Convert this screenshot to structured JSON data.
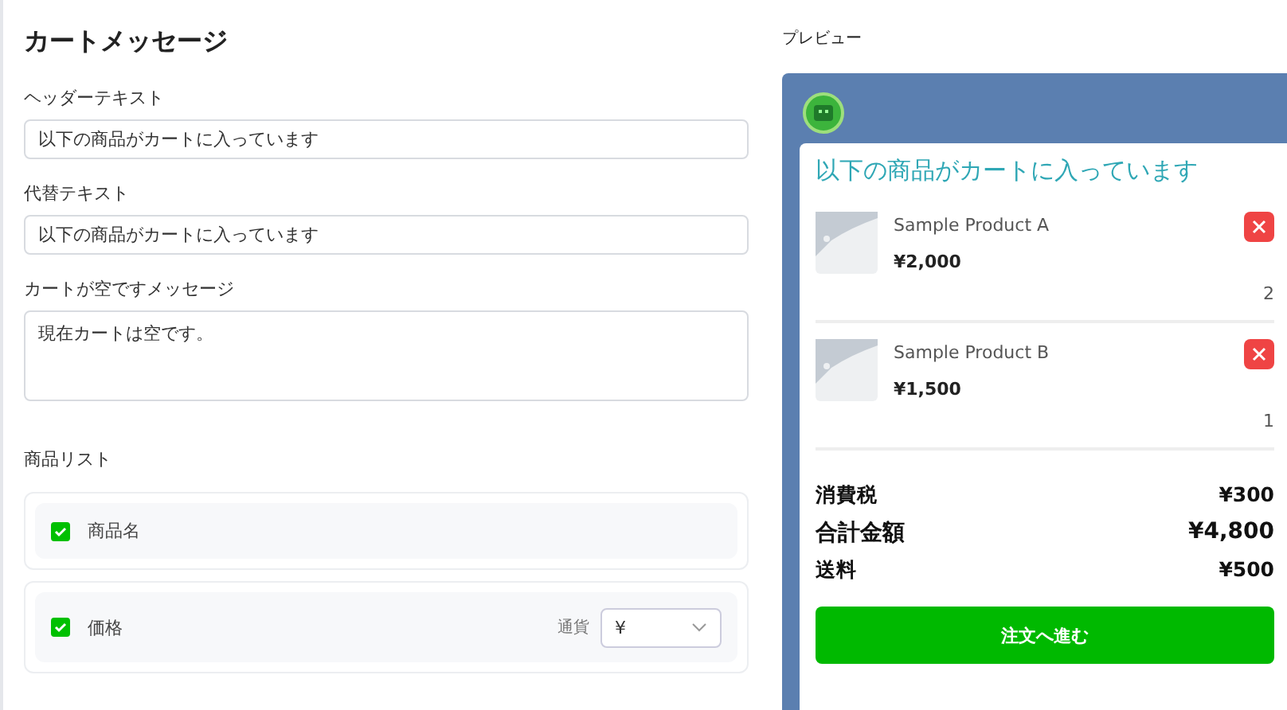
{
  "settings": {
    "title": "カートメッセージ",
    "fields": [
      {
        "label": "ヘッダーテキスト",
        "value": "以下の商品がカートに入っています",
        "kind": "input"
      },
      {
        "label": "代替テキスト",
        "value": "以下の商品がカートに入っています",
        "kind": "input"
      },
      {
        "label": "カートが空ですメッセージ",
        "value": "現在カートは空です。",
        "kind": "textarea"
      }
    ],
    "product_list": {
      "title": "商品リスト",
      "items": [
        {
          "label": "商品名",
          "checked": true
        },
        {
          "label": "価格",
          "checked": true,
          "currency_label": "通貨",
          "currency_value": "¥"
        }
      ]
    }
  },
  "preview": {
    "label": "プレビュー",
    "header": "以下の商品がカートに入っています",
    "products": [
      {
        "name": "Sample Product A",
        "price": "¥2,000",
        "quantity": "2"
      },
      {
        "name": "Sample Product B",
        "price": "¥1,500",
        "quantity": "1"
      }
    ],
    "summary": [
      {
        "label": "消費税",
        "value": "¥300",
        "emphasis": false
      },
      {
        "label": "合計金額",
        "value": "¥4,800",
        "emphasis": true
      },
      {
        "label": "送料",
        "value": "¥500",
        "emphasis": false
      }
    ],
    "button": "注文へ進む"
  }
}
